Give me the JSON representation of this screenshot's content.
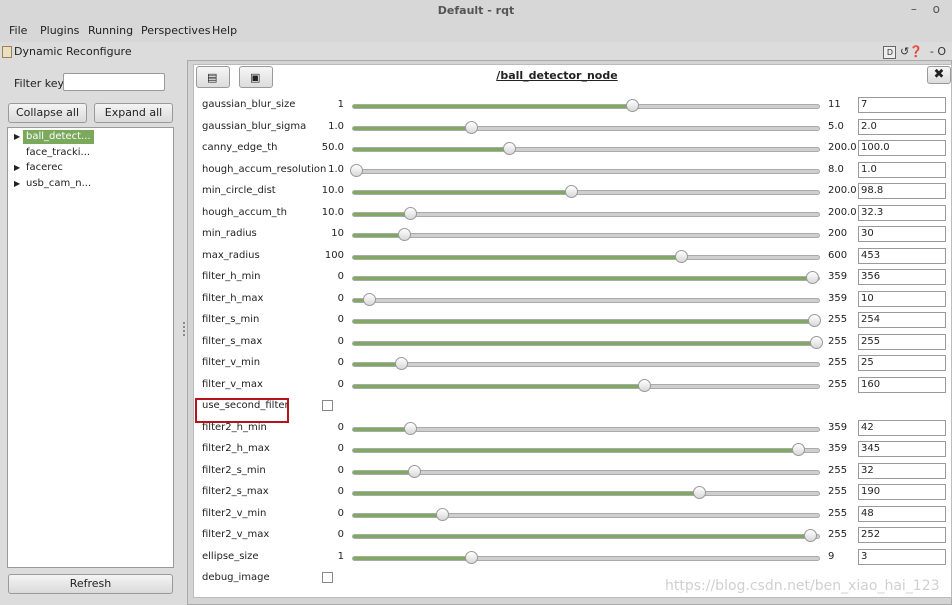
{
  "window": {
    "title": "Default - rqt",
    "controls": "– o"
  },
  "menu": [
    "File",
    "Plugins",
    "Running",
    "Perspectives",
    "Help"
  ],
  "plugin": {
    "title": "Dynamic Reconfigure",
    "controls_label": "D",
    "controls_icons": "↺❓",
    "controls_extra": "- O"
  },
  "filter": {
    "label": "Filter key:",
    "value": ""
  },
  "buttons": {
    "collapse": "Collapse all",
    "expand": "Expand all",
    "refresh": "Refresh"
  },
  "tree": [
    {
      "label": "ball_detect...",
      "arrow": "▶",
      "selected": true
    },
    {
      "label": "face_tracki...",
      "arrow": "",
      "selected": false
    },
    {
      "label": "facerec",
      "arrow": "▶",
      "selected": false
    },
    {
      "label": "usb_cam_n...",
      "arrow": "▶",
      "selected": false
    }
  ],
  "node": {
    "title": "/ball_detector_node",
    "close": "✖"
  },
  "params": [
    {
      "name": "gaussian_blur_size",
      "type": "slider",
      "min": "1",
      "max": "11",
      "value": "7",
      "frac": 0.6
    },
    {
      "name": "gaussian_blur_sigma",
      "type": "slider",
      "min": "1.0",
      "max": "5.0",
      "value": "2.0",
      "frac": 0.25
    },
    {
      "name": "canny_edge_th",
      "type": "slider",
      "min": "50.0",
      "max": "200.0",
      "value": "100.0",
      "frac": 0.333
    },
    {
      "name": "hough_accum_resolution",
      "type": "slider",
      "min": "1.0",
      "max": "8.0",
      "value": "1.0",
      "frac": 0.0
    },
    {
      "name": "min_circle_dist",
      "type": "slider",
      "min": "10.0",
      "max": "200.0",
      "value": "98.8",
      "frac": 0.467
    },
    {
      "name": "hough_accum_th",
      "type": "slider",
      "min": "10.0",
      "max": "200.0",
      "value": "32.3",
      "frac": 0.117
    },
    {
      "name": "min_radius",
      "type": "slider",
      "min": "10",
      "max": "200",
      "value": "30",
      "frac": 0.105
    },
    {
      "name": "max_radius",
      "type": "slider",
      "min": "100",
      "max": "600",
      "value": "453",
      "frac": 0.706
    },
    {
      "name": "filter_h_min",
      "type": "slider",
      "min": "0",
      "max": "359",
      "value": "356",
      "frac": 0.992
    },
    {
      "name": "filter_h_max",
      "type": "slider",
      "min": "0",
      "max": "359",
      "value": "10",
      "frac": 0.028
    },
    {
      "name": "filter_s_min",
      "type": "slider",
      "min": "0",
      "max": "255",
      "value": "254",
      "frac": 0.996
    },
    {
      "name": "filter_s_max",
      "type": "slider",
      "min": "0",
      "max": "255",
      "value": "255",
      "frac": 1.0
    },
    {
      "name": "filter_v_min",
      "type": "slider",
      "min": "0",
      "max": "255",
      "value": "25",
      "frac": 0.098
    },
    {
      "name": "filter_v_max",
      "type": "slider",
      "min": "0",
      "max": "255",
      "value": "160",
      "frac": 0.627
    },
    {
      "name": "use_second_filter",
      "type": "checkbox",
      "checked": false
    },
    {
      "name": "filter2_h_min",
      "type": "slider",
      "min": "0",
      "max": "359",
      "value": "42",
      "frac": 0.117
    },
    {
      "name": "filter2_h_max",
      "type": "slider",
      "min": "0",
      "max": "359",
      "value": "345",
      "frac": 0.961
    },
    {
      "name": "filter2_s_min",
      "type": "slider",
      "min": "0",
      "max": "255",
      "value": "32",
      "frac": 0.125
    },
    {
      "name": "filter2_s_max",
      "type": "slider",
      "min": "0",
      "max": "255",
      "value": "190",
      "frac": 0.745
    },
    {
      "name": "filter2_v_min",
      "type": "slider",
      "min": "0",
      "max": "255",
      "value": "48",
      "frac": 0.188
    },
    {
      "name": "filter2_v_max",
      "type": "slider",
      "min": "0",
      "max": "255",
      "value": "252",
      "frac": 0.988
    },
    {
      "name": "ellipse_size",
      "type": "slider",
      "min": "1",
      "max": "9",
      "value": "3",
      "frac": 0.25
    },
    {
      "name": "debug_image",
      "type": "checkbox",
      "checked": false
    }
  ],
  "watermark": "https://blog.csdn.net/ben_xiao_hai_123",
  "colors": {
    "fill": "#7fa960",
    "selected": "#7aa95c",
    "highlight": "#b5141b"
  }
}
